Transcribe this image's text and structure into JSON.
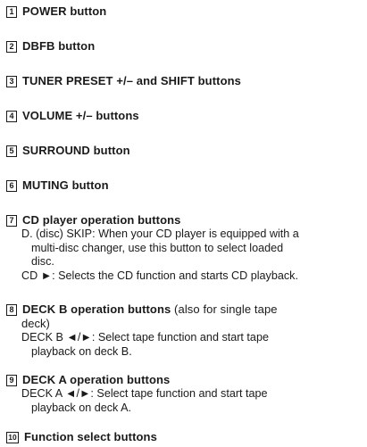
{
  "items": [
    {
      "num": "1",
      "title": "POWER button"
    },
    {
      "num": "2",
      "title": "DBFB button"
    },
    {
      "num": "3",
      "title": "TUNER PRESET +/– and SHIFT buttons"
    },
    {
      "num": "4",
      "title": "VOLUME +/– buttons"
    },
    {
      "num": "5",
      "title": "SURROUND button"
    },
    {
      "num": "6",
      "title": "MUTING button"
    },
    {
      "num": "7",
      "title": "CD player operation buttons",
      "desc": [
        "D. (disc) SKIP: When your CD player is equipped with a",
        "multi-disc changer, use this button to select loaded",
        "disc.",
        "CD ►: Selects the CD function and starts CD playback."
      ]
    },
    {
      "num": "8",
      "title": "DECK B operation buttons",
      "title_suffix": " (also for single tape",
      "title_line2": "deck)",
      "desc": [
        "DECK B ◄/►: Select tape function and start tape",
        "playback on deck B."
      ]
    },
    {
      "num": "9",
      "title": "DECK A operation buttons",
      "desc": [
        "DECK A ◄/►: Select tape function and start tape",
        "playback on deck A."
      ]
    },
    {
      "num": "10",
      "title": "Function select buttons"
    }
  ]
}
